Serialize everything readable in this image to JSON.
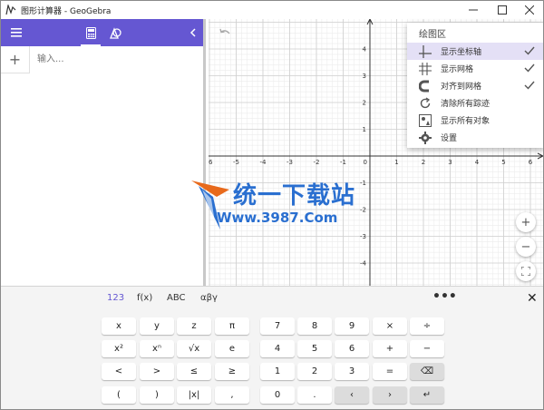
{
  "window": {
    "title": "图形计算器 - GeoGebra",
    "controls": [
      "minimize",
      "maximize",
      "close"
    ]
  },
  "algebra": {
    "input_placeholder": "输入...",
    "plus_label": "+"
  },
  "graphics": {
    "x_ticks": [
      "-6",
      "-5",
      "-4",
      "-3",
      "-2",
      "-1",
      "0",
      "1",
      "2",
      "3",
      "4",
      "5",
      "6"
    ],
    "y_ticks": [
      "4",
      "3",
      "2",
      "1",
      "-1",
      "-2",
      "-3",
      "-4"
    ],
    "x_range": [
      -6,
      6
    ],
    "y_range": [
      -4,
      4
    ],
    "zoom_in_label": "+",
    "zoom_out_label": "−"
  },
  "menu": {
    "title": "绘图区",
    "items": [
      {
        "label": "显示坐标轴",
        "checked": true,
        "active": true,
        "icon": "axes-icon"
      },
      {
        "label": "显示网格",
        "checked": true,
        "active": false,
        "icon": "grid-icon"
      },
      {
        "label": "对齐到网格",
        "checked": true,
        "active": false,
        "icon": "magnet-icon"
      },
      {
        "label": "清除所有踪迹",
        "checked": false,
        "active": false,
        "icon": "refresh-icon"
      },
      {
        "label": "显示所有对象",
        "checked": false,
        "active": false,
        "icon": "show-all-icon"
      },
      {
        "label": "设置",
        "checked": false,
        "active": false,
        "icon": "gear-icon"
      }
    ]
  },
  "watermark": {
    "line1": "统一下载站",
    "line2": "Www.3987.Com"
  },
  "keyboard": {
    "tabs": [
      "123",
      "f(x)",
      "ABC",
      "αβγ"
    ],
    "active_tab": "123",
    "more_label": "•••",
    "close_label": "✕",
    "left_keys": [
      [
        "x",
        "y",
        "z",
        "π"
      ],
      [
        "x²",
        "xⁿ",
        "√x",
        "e"
      ],
      [
        "<",
        ">",
        "≤",
        "≥"
      ],
      [
        "(",
        ")",
        "|x|",
        ","
      ]
    ],
    "right_keys": [
      [
        "7",
        "8",
        "9",
        "×",
        "÷"
      ],
      [
        "4",
        "5",
        "6",
        "+",
        "−"
      ],
      [
        "1",
        "2",
        "3",
        "=",
        "⌫"
      ],
      [
        "0",
        ".",
        "‹",
        "›",
        "↵"
      ]
    ]
  },
  "colors": {
    "accent": "#6557d2",
    "watermark": "#2a6fd0"
  }
}
